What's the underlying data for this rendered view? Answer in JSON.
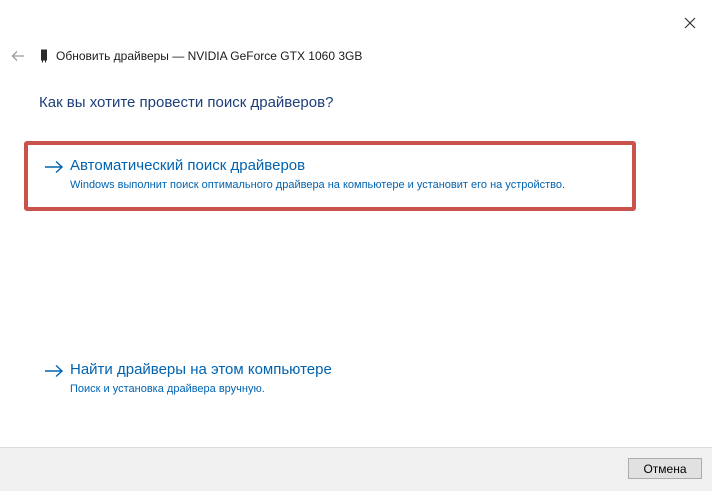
{
  "window": {
    "title": "Обновить драйверы — NVIDIA GeForce GTX 1060 3GB",
    "heading": "Как вы хотите провести поиск драйверов?"
  },
  "options": [
    {
      "title": "Автоматический поиск драйверов",
      "description": "Windows выполнит поиск оптимального драйвера на компьютере и установит его на устройство.",
      "highlighted": true
    },
    {
      "title": "Найти драйверы на этом компьютере",
      "description": "Поиск и установка драйвера вручную.",
      "highlighted": false
    }
  ],
  "footer": {
    "cancel_label": "Отмена"
  },
  "icons": {
    "close": "close-icon",
    "back": "back-arrow-icon",
    "device": "graphics-card-icon",
    "option_arrow": "arrow-right-icon"
  },
  "colors": {
    "link": "#0063b1",
    "heading": "#1e3f7a",
    "highlight_border": "#c9534a",
    "footer_bg": "#f0f0f0"
  }
}
